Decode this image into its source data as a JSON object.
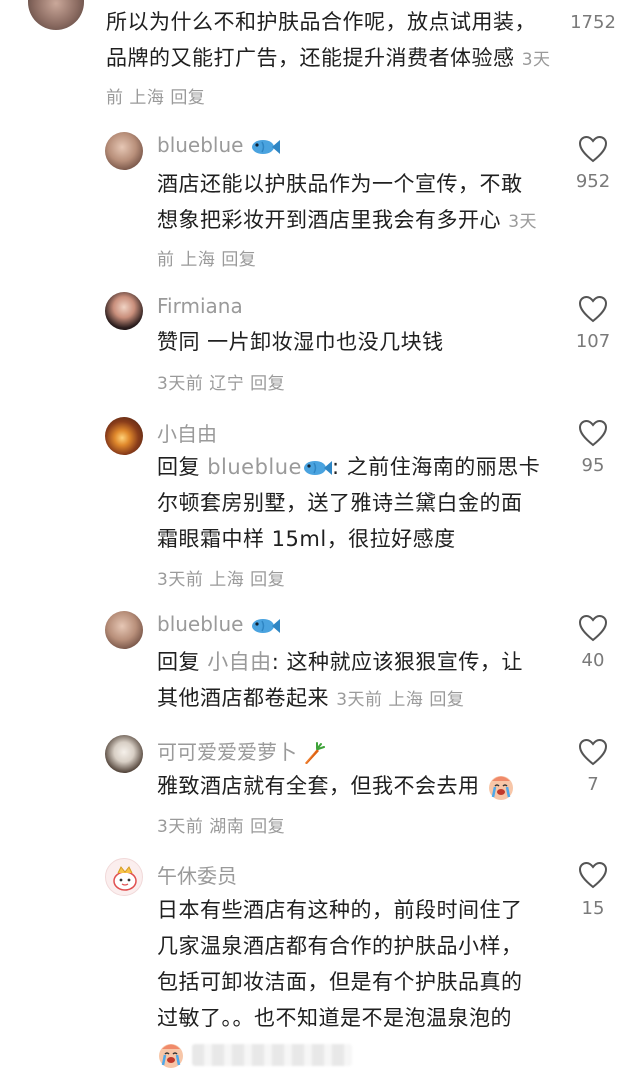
{
  "top_comment": {
    "text": "所以为什么不和护肤品合作呢，放点试用装，品牌的又能打广告，还能提升消费者体验感",
    "time": "3天前",
    "location": "上海",
    "reply_label": "回复",
    "likes": "1752"
  },
  "comments": [
    {
      "user": "blueblue",
      "text": "酒店还能以护肤品作为一个宣传，不敢想象把彩妆开到酒店里我会有多开心",
      "time": "3天前",
      "location": "上海",
      "reply_label": "回复",
      "likes": "952"
    },
    {
      "user": "Firmiana",
      "text": "赞同 一片卸妆湿巾也没几块钱",
      "time": "3天前",
      "location": "辽宁",
      "reply_label": "回复",
      "likes": "107"
    },
    {
      "user": "小自由",
      "reply_prefix": "回复",
      "reply_to": "blueblue",
      "text": ": 之前住海南的丽思卡尔顿套房别墅，送了雅诗兰黛白金的面霜眼霜中样 15ml，很拉好感度",
      "time": "3天前",
      "location": "上海",
      "reply_label": "回复",
      "likes": "95"
    },
    {
      "user": "blueblue",
      "reply_prefix": "回复",
      "reply_to": "小自由",
      "text": ": 这种就应该狠狠宣传，让其他酒店都卷起来",
      "time": "3天前",
      "location": "上海",
      "reply_label": "回复",
      "likes": "40"
    },
    {
      "user": "可可爱爱爱萝卜",
      "text": "雅致酒店就有全套，但我不会去用",
      "time": "3天前",
      "location": "湖南",
      "reply_label": "回复",
      "likes": "7"
    },
    {
      "user": "午休委员",
      "text": "日本有些酒店有这种的，前段时间住了几家温泉酒店都有合作的护肤品小样，包括可卸妆洁面，但是有个护肤品真的过敏了。。也不知道是不是泡温泉泡的",
      "likes": "15"
    }
  ],
  "colors": {
    "text": "#1f1f1f",
    "meta": "#9a9a9a",
    "like_count": "#7a7a7a",
    "background": "#ffffff"
  },
  "icons": [
    "heart-outline-icon",
    "fish-emoji-icon",
    "carrot-emoji-icon",
    "crying-face-emoji-icon"
  ]
}
